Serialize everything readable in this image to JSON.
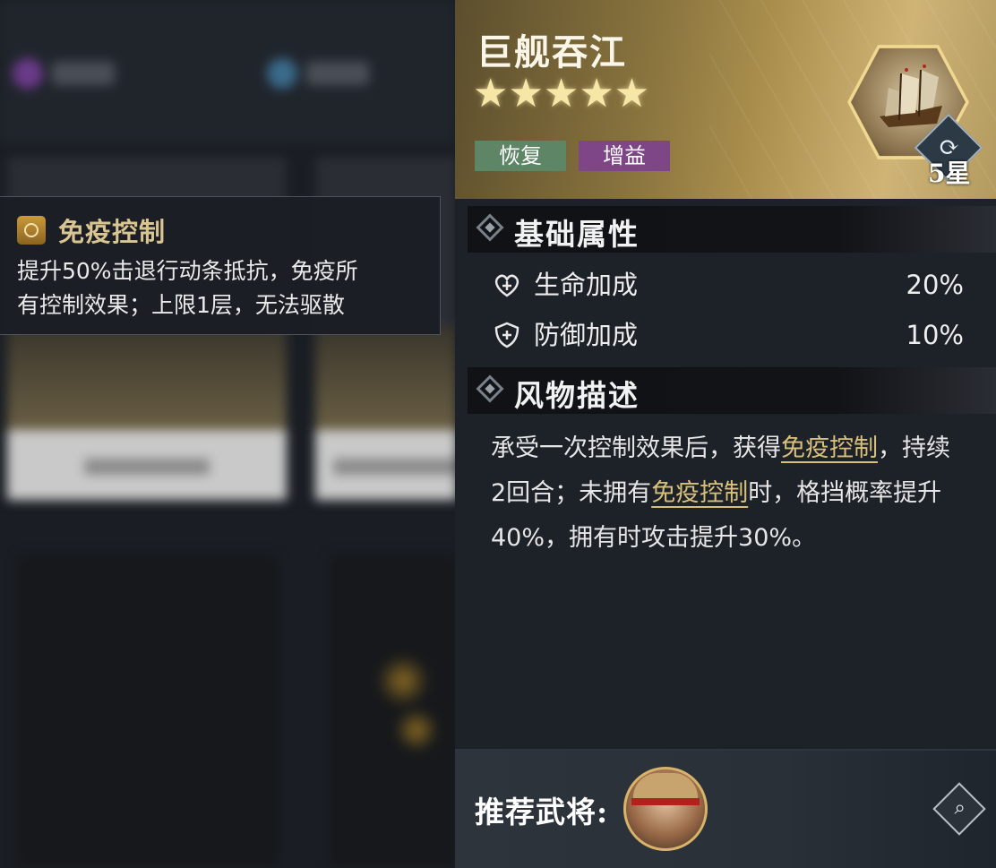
{
  "tooltip": {
    "icon": "shield-badge-icon",
    "title": "免疫控制",
    "line1": "提升50%击退行动条抵抗，免疫所",
    "line2": "有控制效果；上限1层，无法驱散"
  },
  "item": {
    "name": "巨舰吞江",
    "stars": "★★★★★",
    "star_count": 5,
    "tags": [
      "恢复",
      "增益"
    ],
    "star_level": "5星",
    "portrait_icon": "warship-icon",
    "swap_icon": "refresh-icon"
  },
  "basic_attributes": {
    "title": "基础属性",
    "stats": [
      {
        "label": "生命加成",
        "value": "20%",
        "icon": "heart-plus-icon"
      },
      {
        "label": "防御加成",
        "value": "10%",
        "icon": "shield-plus-icon"
      }
    ]
  },
  "description": {
    "title": "风物描述",
    "text_1": "承受一次控制效果后，获得",
    "kw_1": "免疫控制",
    "text_2": "，持续2回合；未拥有",
    "kw_2": "免疫控制",
    "text_3": "时，格挡概率提升40%，拥有时攻击提升30%。"
  },
  "footer": {
    "label": "推荐武将:",
    "avatar": "general-avatar",
    "search_icon": "magnifier-icon"
  },
  "colors": {
    "tag_heal": "#5e8566",
    "tag_buff": "#7e4686",
    "keyword": "#d9c07a",
    "tooltip_title": "#d8c592"
  }
}
